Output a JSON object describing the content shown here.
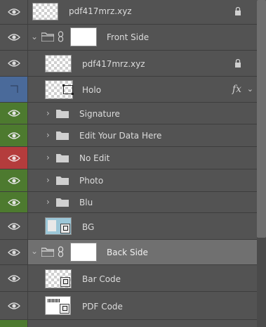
{
  "layers": [
    {
      "id": "layer-pdf417-top",
      "name": "pdf417mrz.xyz",
      "eye_color": "",
      "thumb": "transparent",
      "locked": true
    },
    {
      "id": "group-front-side",
      "name": "Front Side",
      "eye_color": "",
      "type": "group",
      "expanded": true
    },
    {
      "id": "layer-pdf417-inner",
      "name": "pdf417mrz.xyz",
      "eye_color": "",
      "thumb": "transparent",
      "locked": true
    },
    {
      "id": "layer-holo",
      "name": "Holo",
      "eye_color": "blue",
      "thumb": "transparent-transform",
      "fx": "fx"
    },
    {
      "id": "group-signature",
      "name": "Signature",
      "eye_color": "green",
      "type": "group",
      "expanded": false
    },
    {
      "id": "group-edit-your-data",
      "name": "Edit Your Data Here",
      "eye_color": "green",
      "type": "group",
      "expanded": false
    },
    {
      "id": "group-no-edit",
      "name": "No Edit",
      "eye_color": "red",
      "type": "group",
      "expanded": false
    },
    {
      "id": "group-photo",
      "name": "Photo",
      "eye_color": "green",
      "type": "group",
      "expanded": false
    },
    {
      "id": "group-blu",
      "name": "Blu",
      "eye_color": "green",
      "type": "group",
      "expanded": false
    },
    {
      "id": "layer-bg",
      "name": "BG",
      "eye_color": "",
      "thumb": "bg"
    },
    {
      "id": "group-back-side",
      "name": "Back Side",
      "eye_color": "",
      "type": "group",
      "expanded": true,
      "selected": true
    },
    {
      "id": "layer-bar-code",
      "name": "Bar Code",
      "eye_color": "",
      "thumb": "transparent-smart"
    },
    {
      "id": "layer-pdf-code",
      "name": "PDF Code",
      "eye_color": "",
      "thumb": "barcode-smart"
    }
  ],
  "colors": {
    "green": "#4d7a2f",
    "red": "#b43c3c",
    "blue": "#4a6a9a"
  },
  "icons": {
    "eye": "eye-icon",
    "lock": "lock-icon",
    "folder": "folder-icon",
    "link": "link-chain-icon",
    "chevron": "chevron-right-icon",
    "expand": "chevron-down-icon",
    "fx": "fx-effects-icon"
  }
}
